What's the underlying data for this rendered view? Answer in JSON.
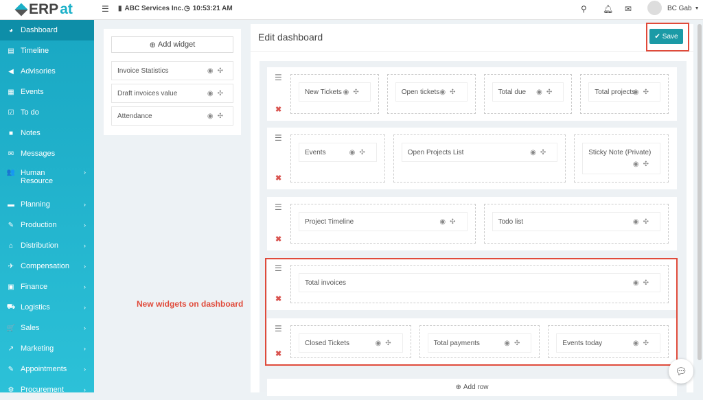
{
  "header": {
    "logo": "ERPat",
    "logo_prefix": "ERP",
    "logo_suffix": "at",
    "company": "ABC Services Inc.",
    "time": "10:53:21 AM",
    "user": "BC Gab"
  },
  "sidebar": [
    {
      "label": "Dashboard",
      "icon": "◕",
      "active": true
    },
    {
      "label": "Timeline",
      "icon": "▤"
    },
    {
      "label": "Advisories",
      "icon": "◀"
    },
    {
      "label": "Events",
      "icon": "▦"
    },
    {
      "label": "To do",
      "icon": "☑"
    },
    {
      "label": "Notes",
      "icon": "■"
    },
    {
      "label": "Messages",
      "icon": "✉"
    },
    {
      "label": "Human Resource",
      "icon": "👥",
      "sub": true,
      "tall": true
    },
    {
      "label": "Planning",
      "icon": "▬",
      "sub": true
    },
    {
      "label": "Production",
      "icon": "✎",
      "sub": true
    },
    {
      "label": "Distribution",
      "icon": "⌂",
      "sub": true
    },
    {
      "label": "Compensation",
      "icon": "✈",
      "sub": true
    },
    {
      "label": "Finance",
      "icon": "▣",
      "sub": true
    },
    {
      "label": "Logistics",
      "icon": "⛟",
      "sub": true
    },
    {
      "label": "Sales",
      "icon": "🛒",
      "sub": true
    },
    {
      "label": "Marketing",
      "icon": "↗",
      "sub": true
    },
    {
      "label": "Appointments",
      "icon": "✎",
      "sub": true
    },
    {
      "label": "Procurement",
      "icon": "⚙",
      "sub": true
    }
  ],
  "widget_panel": {
    "add_label": "Add widget",
    "available": [
      "Invoice Statistics",
      "Draft invoices value",
      "Attendance"
    ]
  },
  "main": {
    "title": "Edit dashboard",
    "save_label": "Save",
    "add_row_label": "Add row",
    "rows": [
      {
        "cols": [
          {
            "span": 3,
            "widget": "New Tickets"
          },
          {
            "span": 3,
            "widget": "Open tickets"
          },
          {
            "span": 3,
            "widget": "Total due"
          },
          {
            "span": 3,
            "widget": "Total projects"
          }
        ]
      },
      {
        "cols": [
          {
            "span": 3,
            "widget": "Events"
          },
          {
            "span": 6,
            "widget": "Open Projects List"
          },
          {
            "span": 3,
            "widget": "Sticky Note (Private)"
          }
        ]
      },
      {
        "cols": [
          {
            "span": 6,
            "widget": "Project Timeline"
          },
          {
            "span": 6,
            "widget": "Todo list"
          }
        ]
      },
      {
        "cols": [
          {
            "span": 12,
            "widget": "Total invoices"
          }
        ]
      },
      {
        "cols": [
          {
            "span": 4,
            "widget": "Closed Tickets"
          },
          {
            "span": 4,
            "widget": "Total payments"
          },
          {
            "span": 4,
            "widget": "Events today"
          }
        ]
      }
    ]
  },
  "annotation": "New widgets on dashboard"
}
